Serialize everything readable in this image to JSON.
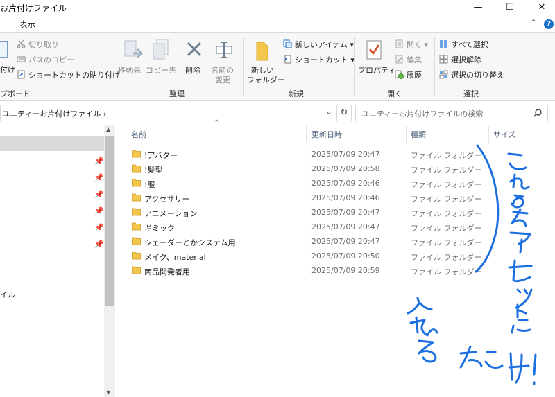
{
  "window": {
    "title": "お片付けファイル",
    "minimize": "—",
    "maximize": "☐",
    "close": "✕"
  },
  "menu": {
    "view": "表示",
    "collapse": "⌃",
    "help": "?"
  },
  "ribbon": {
    "clipboard": {
      "cut": "切り取り",
      "copy_path": "パスのコピー",
      "paste_shortcut": "ショートカットの貼り付け",
      "paste_partial": "付け",
      "group": "プボード"
    },
    "organize": {
      "move_to": "移動先",
      "copy_to": "コピー先",
      "delete": "削除",
      "rename_1": "名前の",
      "rename_2": "変更",
      "group": "整理"
    },
    "new": {
      "new_folder_1": "新しい",
      "new_folder_2": "フォルダー",
      "new_item": "新しいアイテム ▾",
      "shortcut": "ショートカット ▾",
      "group": "新規"
    },
    "open": {
      "properties": "プロパティ",
      "open": "開く ▾",
      "edit": "編集",
      "history": "履歴",
      "group": "開く"
    },
    "select": {
      "select_all": "すべて選択",
      "select_none": "選択解除",
      "invert": "選択の切り替え",
      "group": "選択"
    }
  },
  "address": {
    "path": "ユニティーお片付けファイル",
    "sep": "›",
    "dropdown": "⌄",
    "refresh": "↻"
  },
  "search": {
    "placeholder": "ユニティーお片付けファイルの検索",
    "icon": "search-icon"
  },
  "nav": {
    "partial_item": "イル"
  },
  "columns": {
    "name": "名前",
    "date": "更新日時",
    "type": "種類",
    "size": "サイズ",
    "sort_arrow": "^"
  },
  "files": [
    {
      "name": "!アバター",
      "date": "2025/07/09 20:47",
      "type": "ファイル フォルダー"
    },
    {
      "name": "!髪型",
      "date": "2025/07/09 20:58",
      "type": "ファイル フォルダー"
    },
    {
      "name": "!服",
      "date": "2025/07/09 20:46",
      "type": "ファイル フォルダー"
    },
    {
      "name": "アクセサリー",
      "date": "2025/07/09 20:46",
      "type": "ファイル フォルダー"
    },
    {
      "name": "アニメーション",
      "date": "2025/07/09 20:47",
      "type": "ファイル フォルダー"
    },
    {
      "name": "ギミック",
      "date": "2025/07/09 20:47",
      "type": "ファイル フォルダー"
    },
    {
      "name": "シェーダーとかシステム用",
      "date": "2025/07/09 20:47",
      "type": "ファイル フォルダー"
    },
    {
      "name": "メイク、material",
      "date": "2025/07/09 20:50",
      "type": "ファイル フォルダー"
    },
    {
      "name": "商品開発者用",
      "date": "2025/07/09 20:59",
      "type": "ファイル フォルダー"
    }
  ],
  "annotation": {
    "line1": "これらをアセットに",
    "line2": "入れるだけ！",
    "color": "#1c6fe0"
  },
  "colors": {
    "folder": "#f3c74b",
    "accent": "#1a6fc9",
    "selection": "#d9d9d9"
  }
}
